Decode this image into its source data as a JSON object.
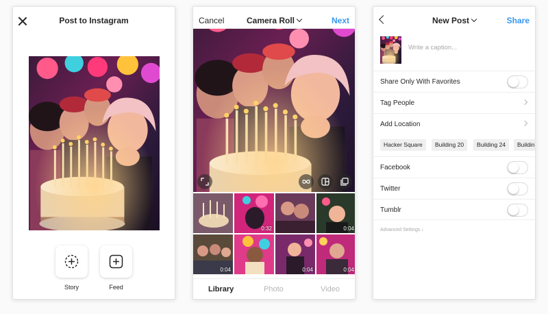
{
  "share_sheet": {
    "title": "Post to Instagram",
    "story_label": "Story",
    "feed_label": "Feed"
  },
  "camera_roll": {
    "cancel_label": "Cancel",
    "title": "Camera Roll",
    "next_label": "Next",
    "tabs": {
      "library": "Library",
      "photo": "Photo",
      "video": "Video"
    },
    "durations": {
      "c1": "0:32",
      "c3": "0:04",
      "c4": "0:04",
      "c6": "0:04",
      "c7": "0:04"
    }
  },
  "new_post": {
    "title": "New Post",
    "share_label": "Share",
    "caption_placeholder": "Write a caption...",
    "share_favorites_label": "Share Only With Favorites",
    "tag_people_label": "Tag People",
    "add_location_label": "Add Location",
    "location_chips": {
      "c0": "Hacker Square",
      "c1": "Building 20",
      "c2": "Building 24",
      "c3": "Buildin"
    },
    "facebook_label": "Facebook",
    "twitter_label": "Twitter",
    "tumblr_label": "Tumblr",
    "advanced_label": "Advanced Settings ›"
  },
  "toggles": {
    "share_favorites": false,
    "facebook": false,
    "twitter": false,
    "tumblr": false
  },
  "icons": {
    "close": "close-icon",
    "story": "story-add-icon",
    "feed": "feed-add-icon",
    "expand": "expand-icon",
    "boomerang": "boomerang-icon",
    "layout": "layout-icon",
    "multi": "multi-select-icon",
    "back": "back-chevron-icon"
  },
  "colors": {
    "accent": "#3897f0",
    "text": "#262626",
    "muted": "#a8a8a8"
  }
}
